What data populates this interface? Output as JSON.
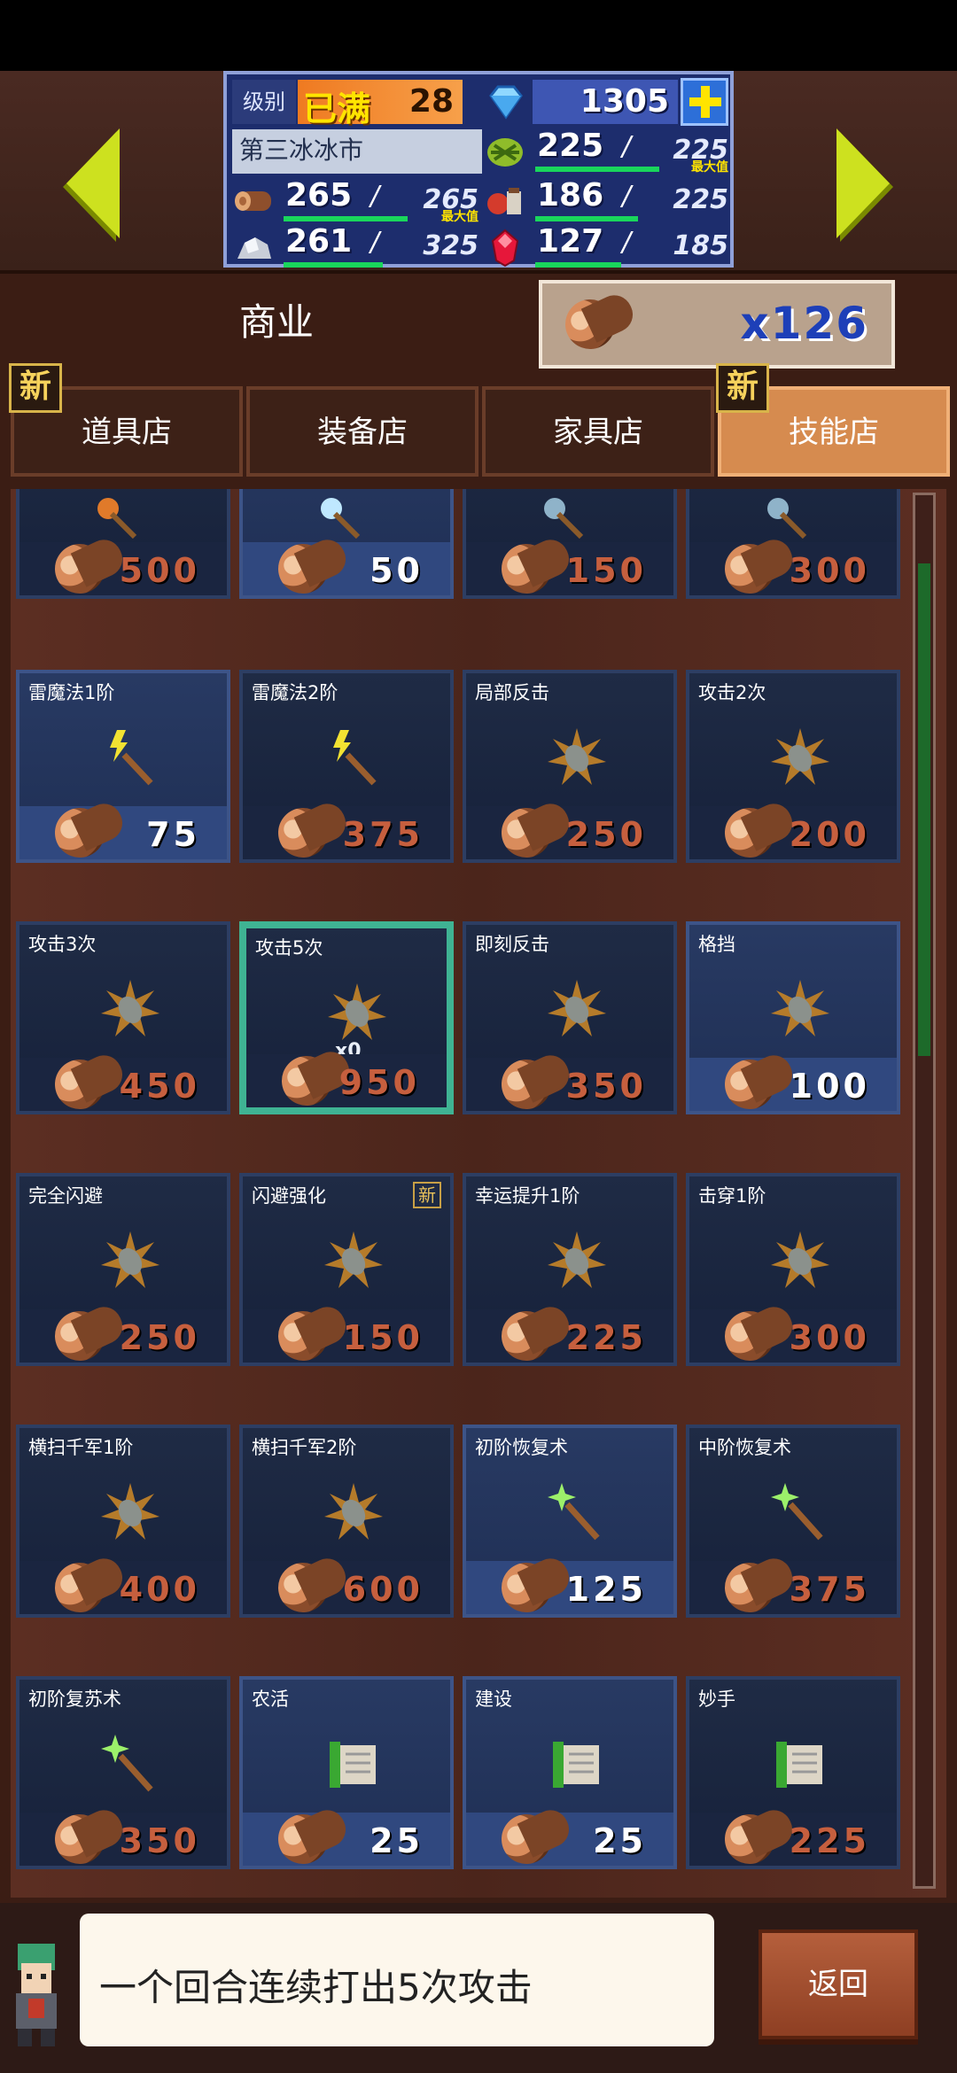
{
  "status": {
    "level_label": "级别",
    "level_status": "已满",
    "level_value": "28",
    "gems": "1305",
    "town_name": "第三冰冰市",
    "resources": [
      {
        "icon": "grass-icon",
        "current": "225",
        "max": "225",
        "max_label": "最大值",
        "fill": 1.0
      },
      {
        "icon": "wood-icon",
        "current": "265",
        "max": "265",
        "max_label": "最大值",
        "fill": 1.0
      },
      {
        "icon": "food-icon",
        "current": "186",
        "max": "225",
        "max_label": "",
        "fill": 0.83
      },
      {
        "icon": "ore-icon",
        "current": "261",
        "max": "325",
        "max_label": "",
        "fill": 0.8
      },
      {
        "icon": "ruby-icon",
        "current": "127",
        "max": "185",
        "max_label": "",
        "fill": 0.69
      }
    ]
  },
  "header": {
    "title": "商业",
    "wood_count": "x126"
  },
  "tabs": [
    {
      "label": "道具店",
      "new": "新",
      "active": false
    },
    {
      "label": "装备店",
      "new": "",
      "active": false
    },
    {
      "label": "家具店",
      "new": "",
      "active": false
    },
    {
      "label": "技能店",
      "new": "新",
      "active": true
    }
  ],
  "top_row_prices": [
    "500",
    "50",
    "150",
    "300"
  ],
  "items": [
    {
      "name": "雷魔法1阶",
      "price": "75",
      "icon": "lightning-wand-icon",
      "affordable": true
    },
    {
      "name": "雷魔法2阶",
      "price": "375",
      "icon": "lightning-wand-icon",
      "affordable": false
    },
    {
      "name": "局部反击",
      "price": "250",
      "icon": "spiked-burst-icon",
      "affordable": false
    },
    {
      "name": "攻击2次",
      "price": "200",
      "icon": "spiked-burst-icon",
      "affordable": false
    },
    {
      "name": "攻击3次",
      "price": "450",
      "icon": "spiked-burst-icon",
      "affordable": false
    },
    {
      "name": "攻击5次",
      "price": "950",
      "icon": "spiked-burst-icon",
      "affordable": false,
      "selected": true,
      "owned": "x0"
    },
    {
      "name": "即刻反击",
      "price": "350",
      "icon": "spiked-burst-icon",
      "affordable": false
    },
    {
      "name": "格挡",
      "price": "100",
      "icon": "spiked-burst-icon",
      "affordable": true
    },
    {
      "name": "完全闪避",
      "price": "250",
      "icon": "spiked-burst-icon",
      "affordable": false
    },
    {
      "name": "闪避强化",
      "price": "150",
      "icon": "spiked-burst-icon",
      "affordable": false,
      "new": "新"
    },
    {
      "name": "幸运提升1阶",
      "price": "225",
      "icon": "spiked-burst-icon",
      "affordable": false
    },
    {
      "name": "击穿1阶",
      "price": "300",
      "icon": "spiked-burst-icon",
      "affordable": false
    },
    {
      "name": "横扫千军1阶",
      "price": "400",
      "icon": "spiked-burst-icon",
      "affordable": false
    },
    {
      "name": "横扫千军2阶",
      "price": "600",
      "icon": "spiked-burst-icon",
      "affordable": false
    },
    {
      "name": "初阶恢复术",
      "price": "125",
      "icon": "heal-wand-icon",
      "affordable": true
    },
    {
      "name": "中阶恢复术",
      "price": "375",
      "icon": "heal-wand-icon",
      "affordable": false
    },
    {
      "name": "初阶复苏术",
      "price": "350",
      "icon": "heal-wand-icon",
      "affordable": false
    },
    {
      "name": "农活",
      "price": "25",
      "icon": "scroll-icon",
      "affordable": true
    },
    {
      "name": "建设",
      "price": "25",
      "icon": "scroll-icon",
      "affordable": true
    },
    {
      "name": "妙手",
      "price": "225",
      "icon": "scroll-icon",
      "affordable": false
    }
  ],
  "tip": {
    "text": "一个回合连续打出5次攻击"
  },
  "back_label": "返回"
}
